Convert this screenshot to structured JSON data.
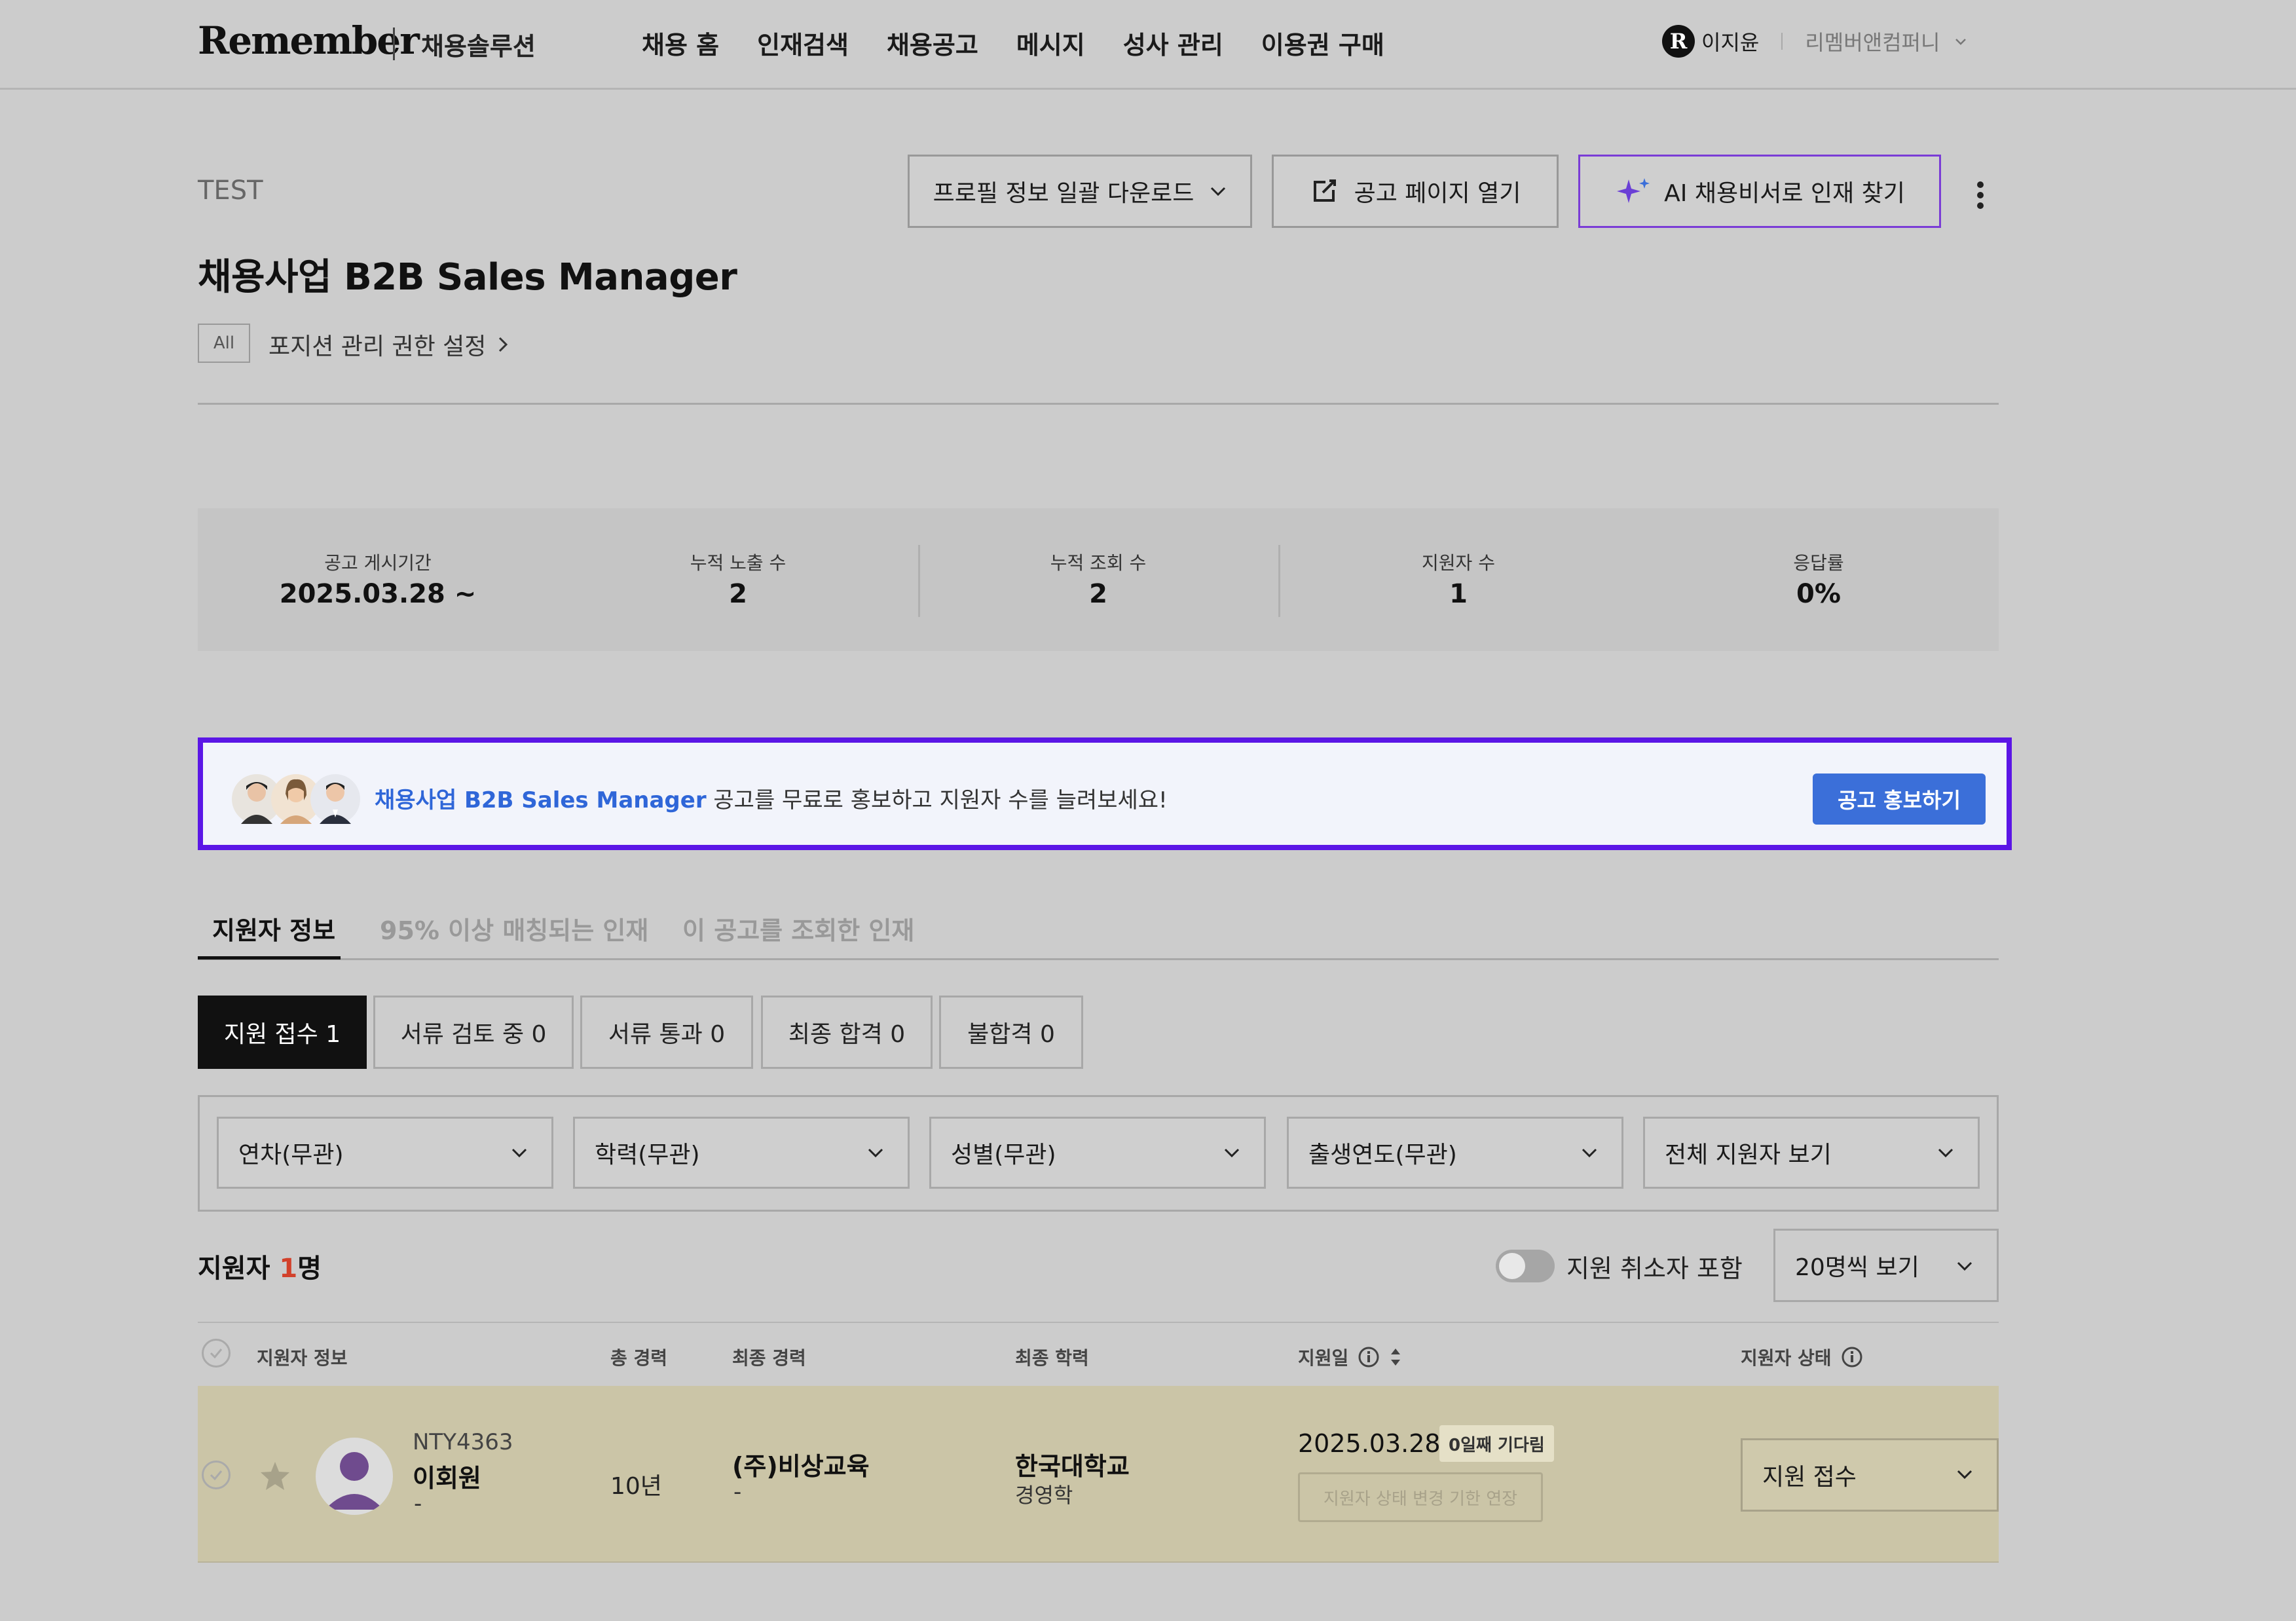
{
  "header": {
    "logo": "Remember",
    "logo_sub": "채용솔루션",
    "nav": [
      "채용 홈",
      "인재검색",
      "채용공고",
      "메시지",
      "성사 관리",
      "이용권 구매"
    ],
    "user_badge": "R",
    "user_name": "이지윤",
    "company": "리멤버앤컴퍼니"
  },
  "job": {
    "test_label": "TEST",
    "title": "채용사업 B2B Sales Manager",
    "all_badge": "All",
    "permission_link": "포지션 관리 권한 설정",
    "download_label": "프로필 정보 일괄 다운로드",
    "open_page_label": "공고 페이지 열기",
    "ai_label": "AI 채용비서로 인재 찾기"
  },
  "stats": [
    {
      "label": "공고 게시기간",
      "value": "2025.03.28 ~"
    },
    {
      "label": "누적 노출 수",
      "value": "2"
    },
    {
      "label": "누적 조회 수",
      "value": "2"
    },
    {
      "label": "지원자 수",
      "value": "1"
    },
    {
      "label": "응답률",
      "value": "0%"
    }
  ],
  "promo": {
    "link_text": "채용사업 B2B Sales Manager",
    "text": " 공고를 무료로 홍보하고 지원자 수를 늘려보세요!",
    "button": "공고 홍보하기"
  },
  "tabs": [
    "지원자 정보",
    "95% 이상 매칭되는 인재",
    "이 공고를 조회한 인재"
  ],
  "status_chips": [
    "지원 접수 1",
    "서류 검토 중 0",
    "서류 통과 0",
    "최종 합격 0",
    "불합격 0"
  ],
  "filters": [
    "연차(무관)",
    "학력(무관)",
    "성별(무관)",
    "출생연도(무관)",
    "전체 지원자 보기"
  ],
  "applicants": {
    "count_prefix": "지원자 ",
    "count_num": "1",
    "count_suffix": "명",
    "include_cancelled": "지원 취소자 포함",
    "per_page": "20명씩 보기"
  },
  "table": {
    "headers": {
      "info": "지원자 정보",
      "career": "총 경력",
      "last_job": "최종 경력",
      "education": "최종 학력",
      "applied": "지원일",
      "status": "지원자 상태"
    },
    "rows": [
      {
        "id": "NTY4363",
        "name": "이회원",
        "sub": "-",
        "career": "10년",
        "last_job": "(주)비상교육",
        "last_job_sub": "-",
        "school": "한국대학교",
        "major": "경영학",
        "date": "2025.03.28",
        "wait_badge": "0일째 기다림",
        "extend_button": "지원자 상태 변경 기한 연장",
        "status": "지원 접수"
      }
    ]
  },
  "colors": {
    "promo_border": "#5b16e6",
    "promo_button": "#3b6fd9",
    "promo_link": "#2f66d8",
    "count_highlight": "#d2412b",
    "row_highlight": "#cbc5a7"
  }
}
